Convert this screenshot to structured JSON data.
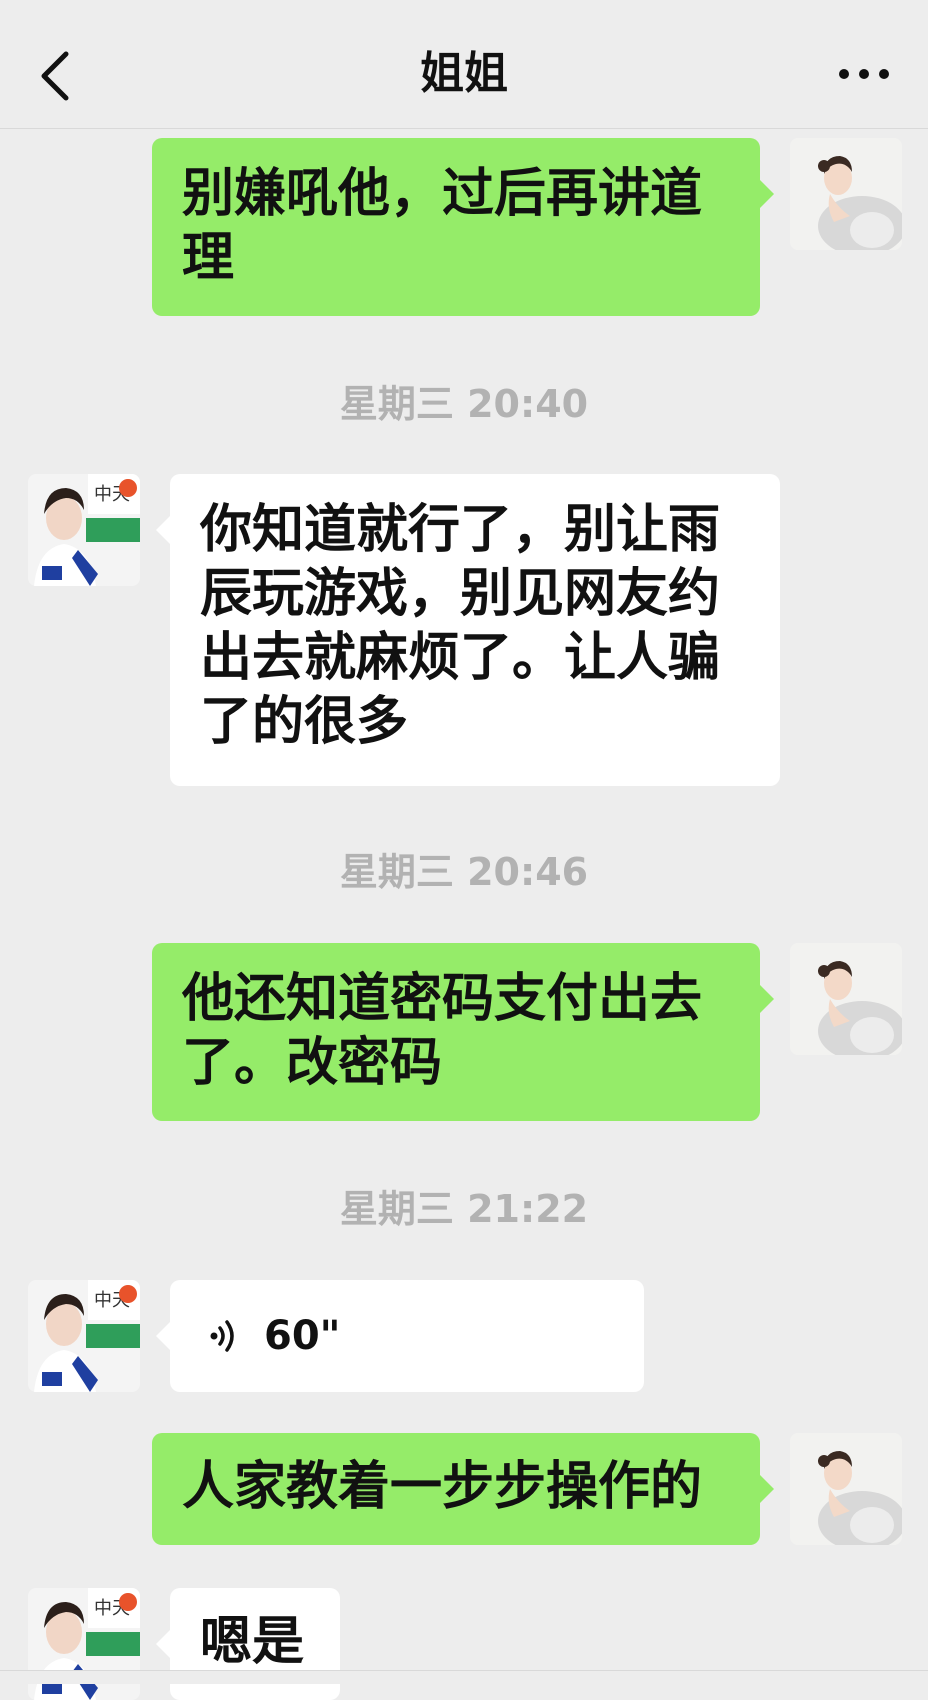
{
  "header": {
    "title": "姐姐",
    "back_icon": "chevron-left-icon",
    "more_icon": "more-dots-icon"
  },
  "colors": {
    "outgoing_bubble": "#95ec69",
    "incoming_bubble": "#ffffff",
    "background": "#ededed",
    "timestamp": "#b2b2b2"
  },
  "messages": {
    "m1": {
      "sender": "me",
      "text": "别嫌吼他，过后再讲道理"
    },
    "t1": {
      "text": "星期三 20:40"
    },
    "m2": {
      "sender": "姐姐",
      "text": "你知道就行了，别让雨辰玩游戏，别见网友约出去就麻烦了。让人骗了的很多"
    },
    "t2": {
      "text": "星期三 20:46"
    },
    "m3": {
      "sender": "me",
      "text": "他还知道密码支付出去了。改密码"
    },
    "t3": {
      "text": "星期三 21:22"
    },
    "m4": {
      "sender": "姐姐",
      "type": "voice",
      "duration": "60\""
    },
    "m5": {
      "sender": "me",
      "text": "人家教着一步步操作的"
    },
    "m6": {
      "sender": "姐姐",
      "text": "嗯是"
    }
  }
}
